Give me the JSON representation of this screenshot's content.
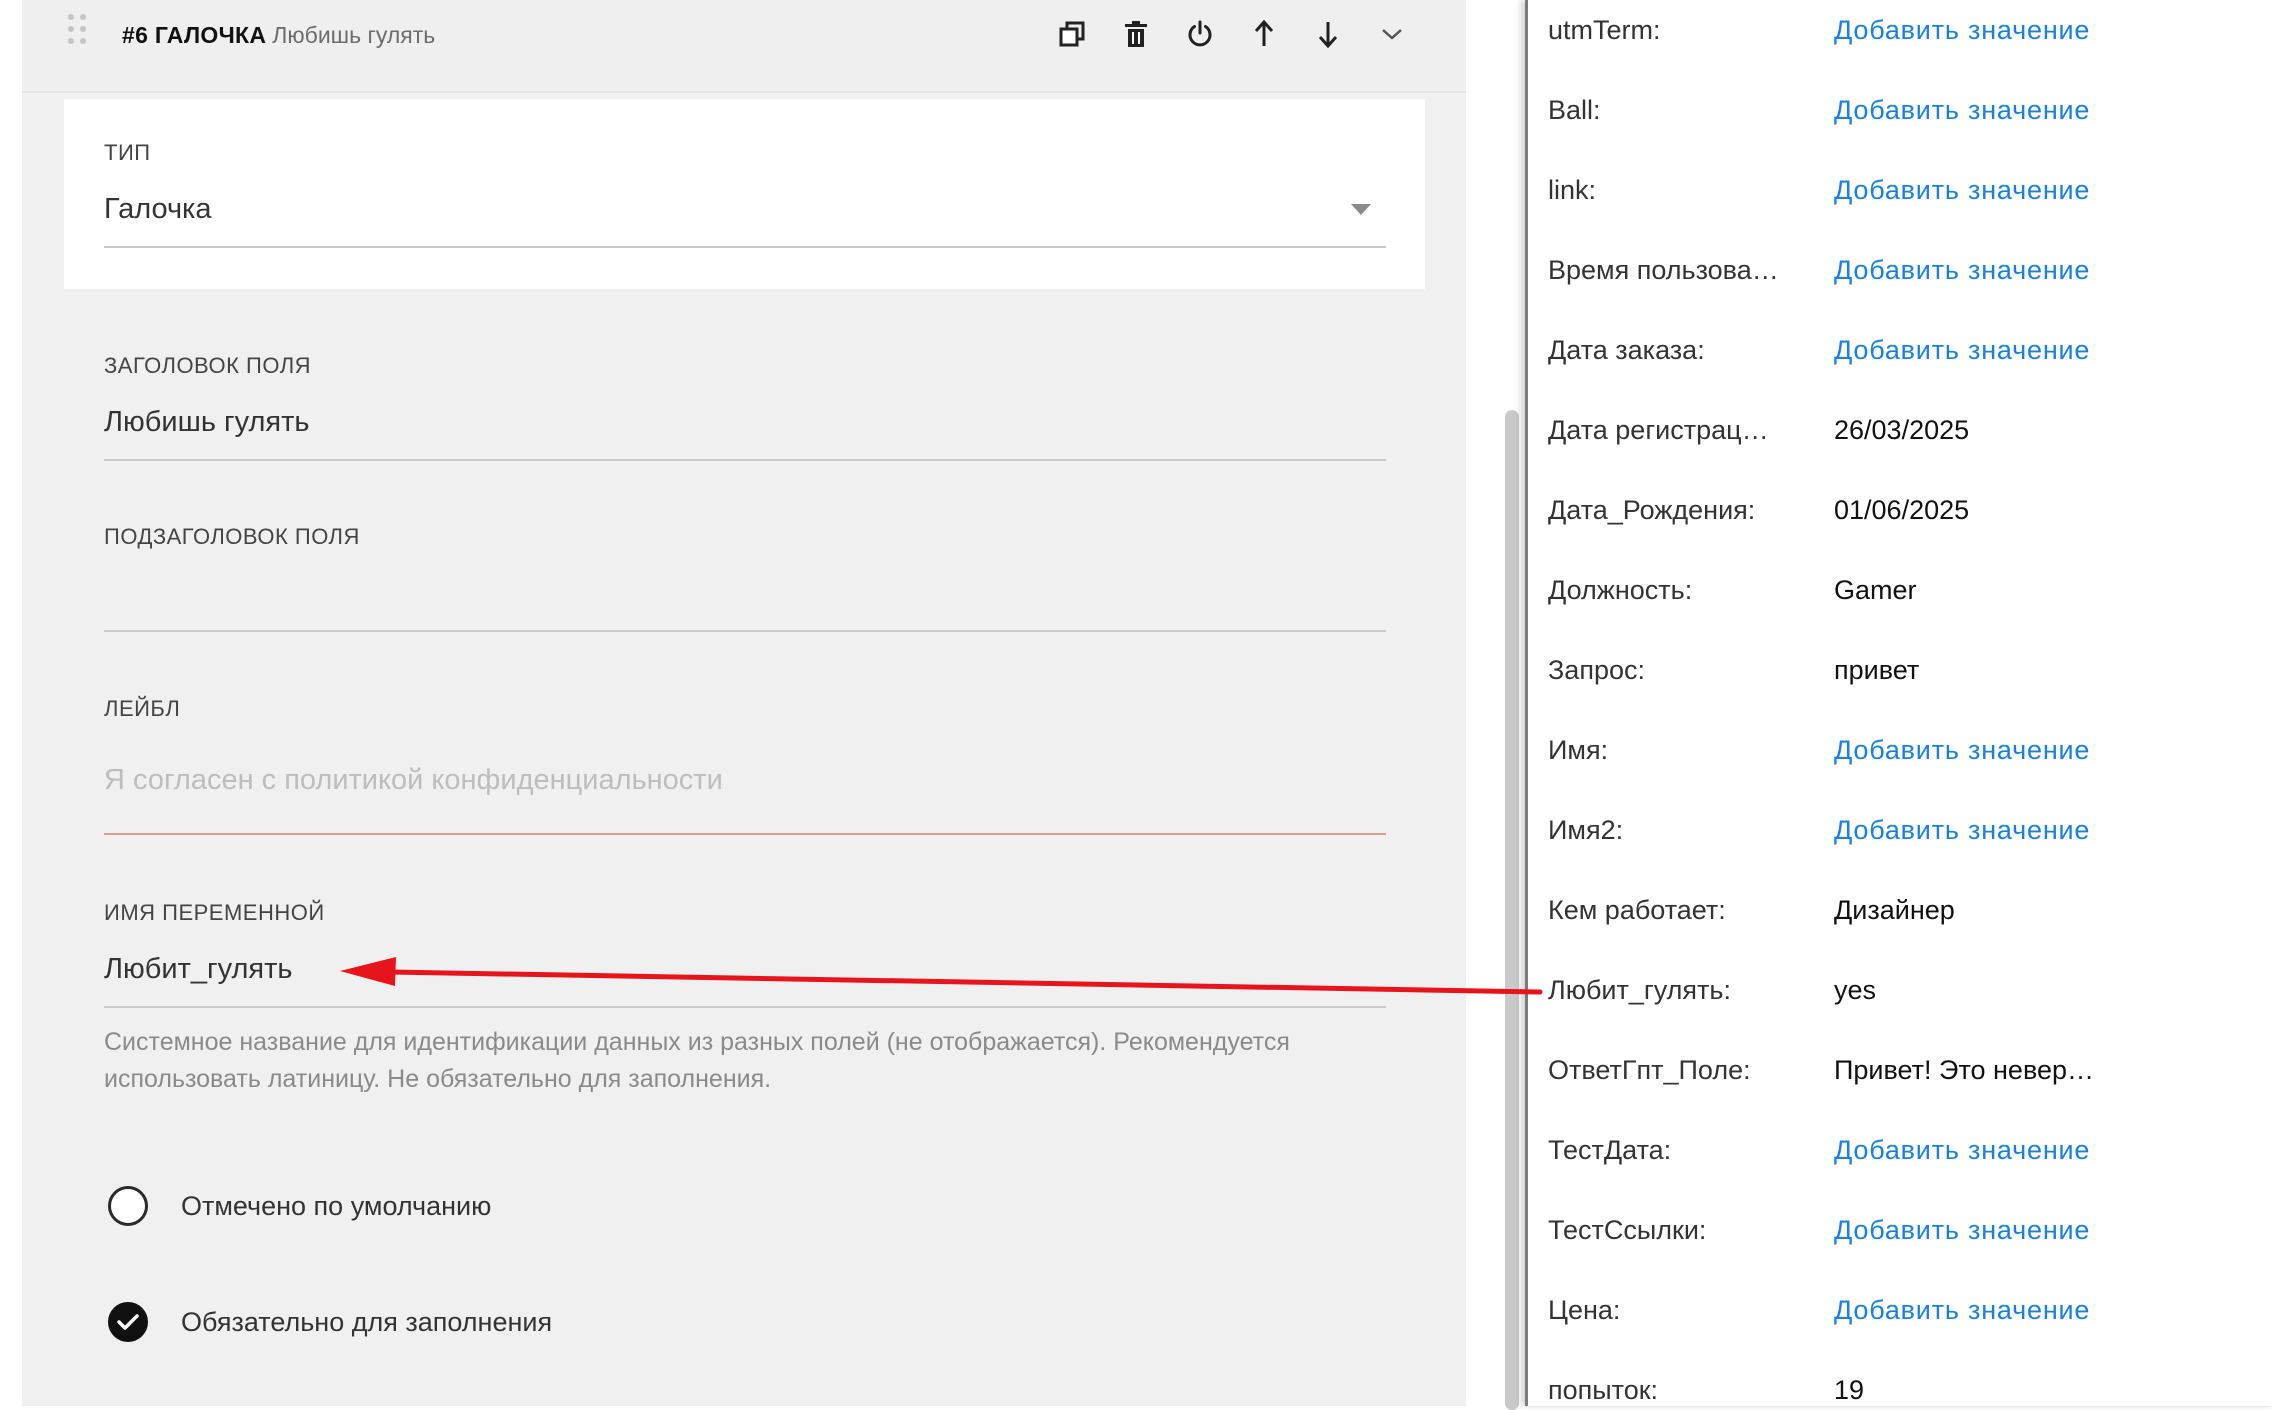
{
  "card": {
    "number": "#6 ГАЛОЧКА",
    "subtitle": "Любишь гулять"
  },
  "toolbar": {
    "icons": [
      "copy-icon",
      "trash-icon",
      "power-icon",
      "arrow-up-icon",
      "arrow-down-icon",
      "chevron-down-icon"
    ]
  },
  "fields": {
    "type": {
      "label": "ТИП",
      "value": "Галочка"
    },
    "title": {
      "label": "ЗАГОЛОВОК ПОЛЯ",
      "value": "Любишь гулять"
    },
    "subtitle": {
      "label": "ПОДЗАГОЛОВОК ПОЛЯ",
      "value": ""
    },
    "label": {
      "label": "ЛЕЙБЛ",
      "placeholder": "Я согласен с политикой конфиденциальности"
    },
    "variable": {
      "label": "ИМЯ ПЕРЕМЕННОЙ",
      "value": "Любит_гулять",
      "hint": "Системное название для идентификации данных из разных полей (не отображается). Рекомендуется использовать латиницу. Не обязательно для заполнения."
    }
  },
  "options": [
    {
      "label": "Отмечено по умолчанию",
      "checked": false
    },
    {
      "label": "Обязательно для заполнения",
      "checked": true
    }
  ],
  "variables": [
    {
      "name": "utmTerm:",
      "value": "Добавить значение",
      "is_link": true
    },
    {
      "name": "Ball:",
      "value": "Добавить значение",
      "is_link": true
    },
    {
      "name": "link:",
      "value": "Добавить значение",
      "is_link": true
    },
    {
      "name": "Время пользова…",
      "value": "Добавить значение",
      "is_link": true
    },
    {
      "name": "Дата заказа:",
      "value": "Добавить значение",
      "is_link": true
    },
    {
      "name": "Дата регистрац…",
      "value": "26/03/2025",
      "is_link": false
    },
    {
      "name": "Дата_Рождения:",
      "value": "01/06/2025",
      "is_link": false
    },
    {
      "name": "Должность:",
      "value": "Gamer",
      "is_link": false
    },
    {
      "name": "Запрос:",
      "value": "привет",
      "is_link": false
    },
    {
      "name": "Имя:",
      "value": "Добавить значение",
      "is_link": true
    },
    {
      "name": "Имя2:",
      "value": "Добавить значение",
      "is_link": true
    },
    {
      "name": "Кем работает:",
      "value": "Дизайнер",
      "is_link": false
    },
    {
      "name": "Любит_гулять:",
      "value": "yes",
      "is_link": false
    },
    {
      "name": "ОтветГпт_Поле:",
      "value": "Привет! Это невер…",
      "is_link": false
    },
    {
      "name": "ТестДата:",
      "value": "Добавить значение",
      "is_link": true
    },
    {
      "name": "ТестСсылки:",
      "value": "Добавить значение",
      "is_link": true
    },
    {
      "name": "Цена:",
      "value": "Добавить значение",
      "is_link": true
    },
    {
      "name": "попыток:",
      "value": "19",
      "is_link": false
    }
  ],
  "colors": {
    "link": "#1a7fe0",
    "annotation_arrow": "#e8141b",
    "error_underline": "#e4998d"
  }
}
